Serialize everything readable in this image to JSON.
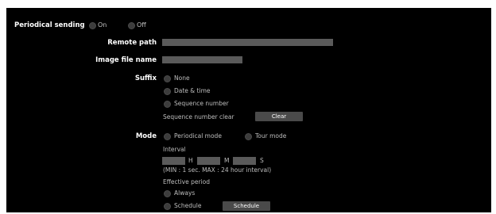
{
  "periodical_sending": {
    "label": "Periodical sending",
    "on_label": "On",
    "off_label": "Off"
  },
  "remote_path": {
    "label": "Remote path",
    "value": ""
  },
  "image_file_name": {
    "label": "Image file name",
    "value": ""
  },
  "suffix": {
    "label": "Suffix",
    "options": [
      "None",
      "Date & time",
      "Sequence number"
    ],
    "seq_clear_label": "Sequence number clear",
    "clear_button": "Clear"
  },
  "mode": {
    "label": "Mode",
    "options": [
      "Periodical mode",
      "Tour mode"
    ],
    "interval_label": "Interval",
    "h_unit": "H",
    "m_unit": "M",
    "s_unit": "S",
    "interval_note": "(MIN : 1 sec. MAX : 24 hour interval)",
    "effective_period_label": "Effective period",
    "period_options": [
      "Always",
      "Schedule"
    ],
    "schedule_button": "Schedule"
  }
}
